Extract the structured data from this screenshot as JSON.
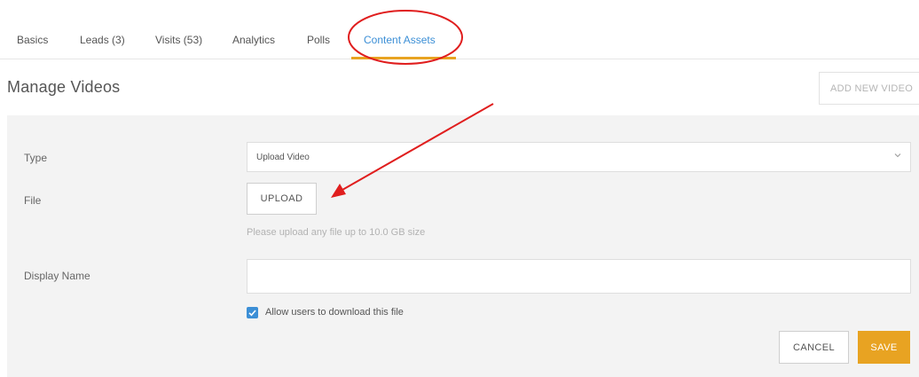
{
  "tabs": [
    {
      "label": "Basics"
    },
    {
      "label": "Leads (3)"
    },
    {
      "label": "Visits (53)"
    },
    {
      "label": "Analytics"
    },
    {
      "label": "Polls"
    },
    {
      "label": "Content Assets",
      "active": true
    }
  ],
  "header": {
    "title": "Manage Videos",
    "add_button": "ADD NEW VIDEO"
  },
  "form": {
    "type_label": "Type",
    "type_value": "Upload Video",
    "file_label": "File",
    "upload_button": "UPLOAD",
    "upload_hint": "Please upload any file up to 10.0 GB size",
    "display_name_label": "Display Name",
    "display_name_value": "",
    "allow_download_label": "Allow users to download this file",
    "allow_download_checked": true,
    "cancel_button": "CANCEL",
    "save_button": "SAVE"
  },
  "colors": {
    "accent_tab": "#3c8fd6",
    "primary": "#e8a322",
    "annotation": "#e01e1e"
  },
  "icons": [
    "chevron-down-icon",
    "checkmark-icon"
  ]
}
